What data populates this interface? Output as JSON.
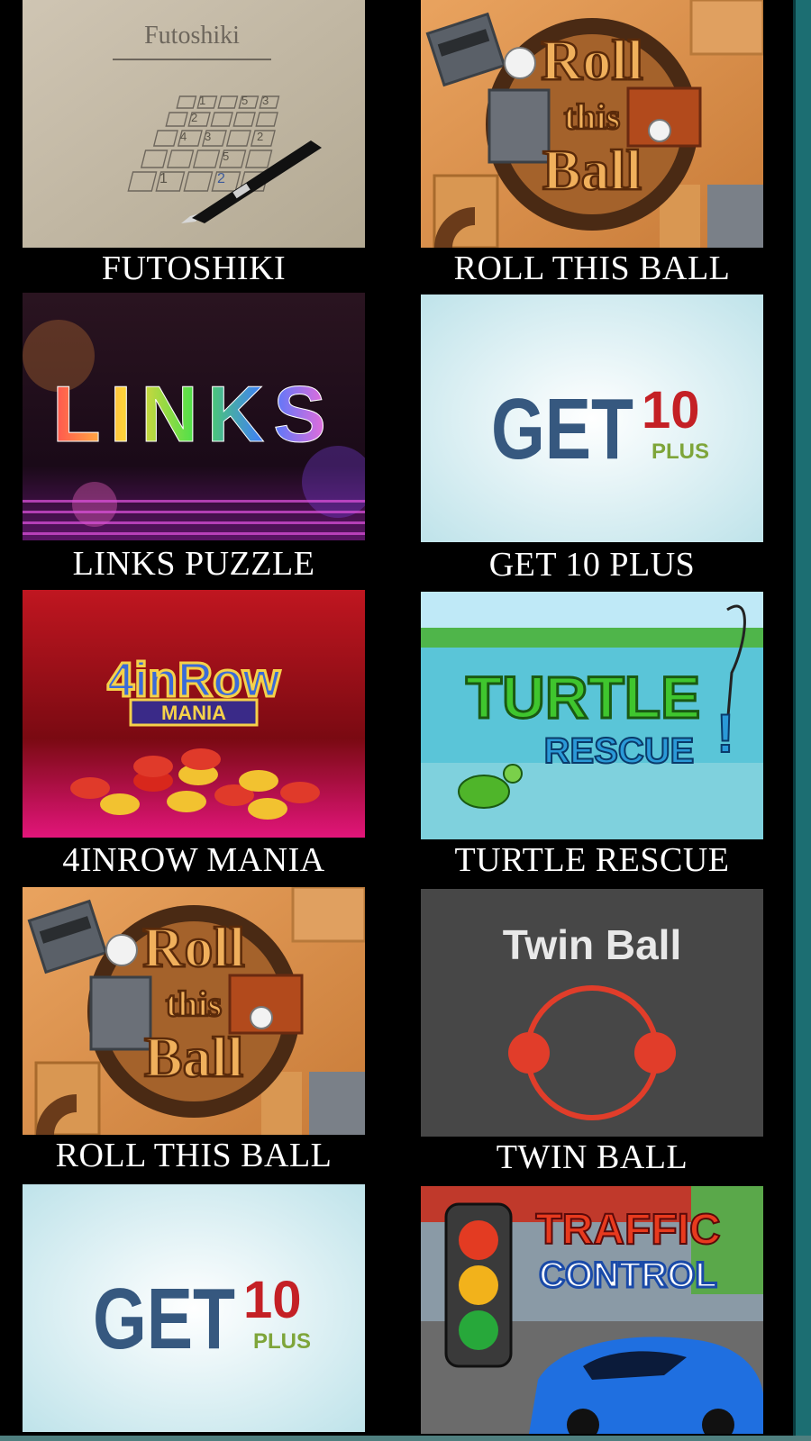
{
  "games": [
    {
      "title": "FUTOSHIKI",
      "logo": "Futoshiki",
      "grid_digits": [
        "1",
        "5",
        "3",
        "2",
        "4",
        "3",
        "2",
        "5",
        "1",
        "2"
      ]
    },
    {
      "title": "ROLL THIS BALL",
      "logo": [
        "Roll",
        "this",
        "Ball"
      ]
    },
    {
      "title": "LINKS PUZZLE",
      "logo": "LINKS"
    },
    {
      "title": "GET 10 PLUS",
      "logo": {
        "main": "GET",
        "num": "10",
        "plus": "PLUS"
      }
    },
    {
      "title": "4INROW MANIA",
      "logo": {
        "main": "4inRow",
        "sub": "MANIA"
      }
    },
    {
      "title": "TURTLE RESCUE",
      "logo": {
        "main": "TURTLE",
        "sub": "RESCUE",
        "mark": "!"
      }
    },
    {
      "title": "ROLL THIS BALL",
      "logo": [
        "Roll",
        "this",
        "Ball"
      ]
    },
    {
      "title": "TWIN BALL",
      "logo": "Twin Ball"
    },
    {
      "title": "GET 10 PLUS",
      "logo": {
        "main": "GET",
        "num": "10",
        "plus": "PLUS"
      }
    },
    {
      "title": "TRAFFIC CONTROL",
      "logo": {
        "main": "TRAFFIC",
        "sub": "CONTROL"
      }
    }
  ]
}
